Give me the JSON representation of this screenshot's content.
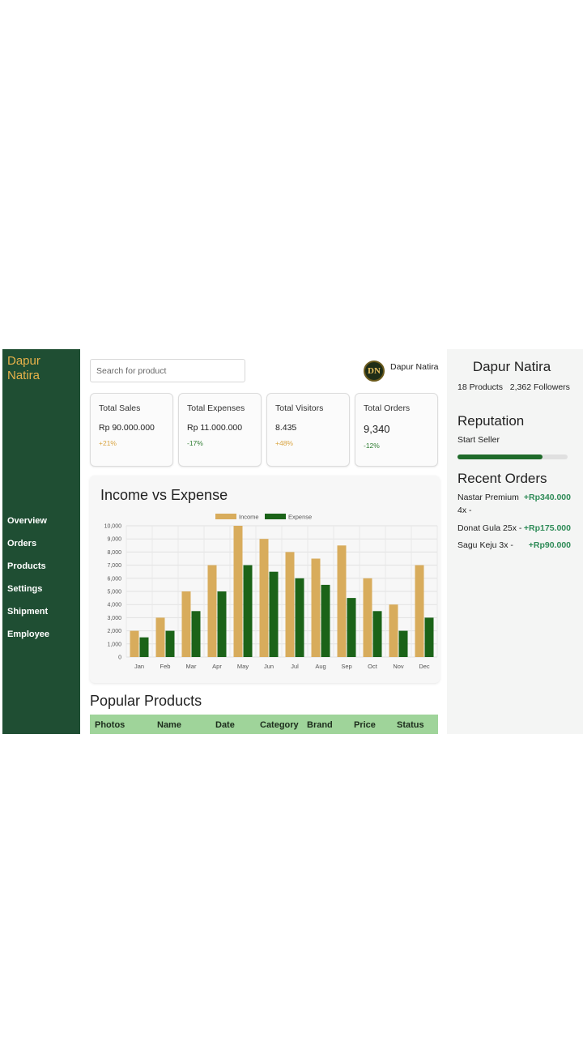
{
  "sidebar": {
    "brand": "Dapur Natira",
    "items": [
      {
        "label": "Overview"
      },
      {
        "label": "Orders"
      },
      {
        "label": "Products"
      },
      {
        "label": "Settings"
      },
      {
        "label": "Shipment"
      },
      {
        "label": "Employee"
      }
    ]
  },
  "header": {
    "search_placeholder": "Search for product",
    "user_name": "Dapur Natira",
    "avatar_initials": "DN"
  },
  "cards": [
    {
      "title": "Total Sales",
      "value": "Rp 90.000.000",
      "change": "+21%",
      "change_color": "#d9a441"
    },
    {
      "title": "Total Expenses",
      "value": "Rp 11.000.000",
      "change": "-17%",
      "change_color": "#2f7d32"
    },
    {
      "title": "Total Visitors",
      "value": "8.435",
      "change": "+48%",
      "change_color": "#d9a441"
    },
    {
      "title": "Total Orders",
      "value": "9,340",
      "change": "-12%",
      "change_color": "#2f7d32"
    }
  ],
  "chart_title": "Income vs Expense",
  "chart_data": {
    "type": "bar",
    "categories": [
      "Jan",
      "Feb",
      "Mar",
      "Apr",
      "May",
      "Jun",
      "Jul",
      "Aug",
      "Sep",
      "Oct",
      "Nov",
      "Dec"
    ],
    "series": [
      {
        "name": "Income",
        "color": "#d8ac5c",
        "values": [
          2000,
          3000,
          5000,
          7000,
          10000,
          9000,
          8000,
          7500,
          8500,
          6000,
          4000,
          7000
        ]
      },
      {
        "name": "Expense",
        "color": "#1b6318",
        "values": [
          1500,
          2000,
          3500,
          5000,
          7000,
          6500,
          6000,
          5500,
          4500,
          3500,
          2000,
          3000
        ]
      }
    ],
    "ylim": [
      0,
      10000
    ],
    "yticks": [
      "0",
      "1,000",
      "2,000",
      "3,000",
      "4,000",
      "5,000",
      "6,000",
      "7,000",
      "8,000",
      "9,000",
      "10,000"
    ],
    "legend": "top-center",
    "grid": true
  },
  "popular": {
    "title": "Popular Products",
    "columns": [
      "Photos",
      "Name",
      "Date",
      "Category",
      "Brand",
      "Price",
      "Status"
    ]
  },
  "shop": {
    "name": "Dapur Natira",
    "stats": "18 Products   2,362 Followers",
    "reputation_title": "Reputation",
    "reputation_label": "Start Seller",
    "reputation_level": 0.77,
    "recent_title": "Recent Orders",
    "orders": [
      {
        "text": "Nastar Premium 4x -",
        "amount": "+Rp340.000"
      },
      {
        "text": "Donat Gula 25x -",
        "amount": "+Rp175.000"
      },
      {
        "text": "Sagu Keju 3x -",
        "amount": "+Rp90.000"
      }
    ]
  }
}
